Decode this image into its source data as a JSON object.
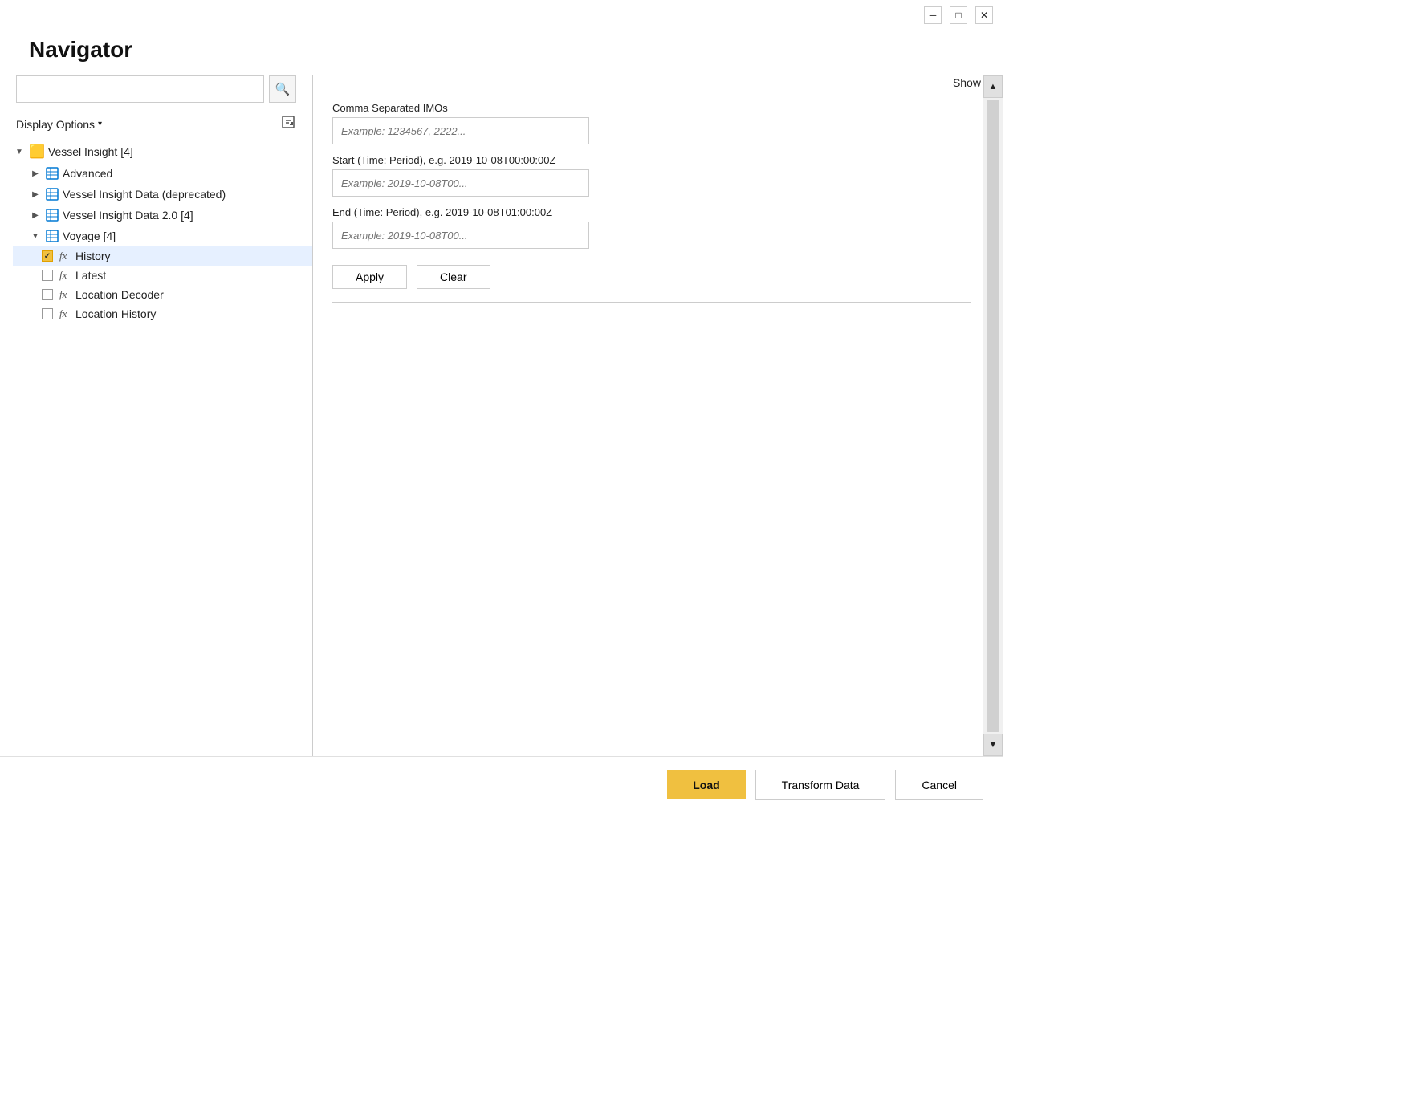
{
  "window": {
    "title": "Navigator",
    "minimize_label": "─",
    "maximize_label": "□",
    "close_label": "✕"
  },
  "search": {
    "placeholder": "",
    "icon": "🔍"
  },
  "display_options": {
    "label": "Display Options",
    "dropdown_icon": "▾"
  },
  "export_icon": "📄",
  "tree": {
    "root": {
      "label": "Vessel Insight [4]",
      "children": [
        {
          "label": "Advanced",
          "type": "table",
          "indent": 1,
          "expandable": true
        },
        {
          "label": "Vessel Insight Data (deprecated)",
          "type": "table",
          "indent": 1,
          "expandable": true
        },
        {
          "label": "Vessel Insight Data 2.0 [4]",
          "type": "table",
          "indent": 1,
          "expandable": true
        },
        {
          "label": "Voyage [4]",
          "type": "table",
          "indent": 1,
          "expandable": true,
          "children": [
            {
              "label": "History",
              "type": "fx",
              "indent": 2,
              "checked": true,
              "selected": true
            },
            {
              "label": "Latest",
              "type": "fx",
              "indent": 2,
              "checked": false
            },
            {
              "label": "Location Decoder",
              "type": "fx",
              "indent": 2,
              "checked": false
            },
            {
              "label": "Location History",
              "type": "fx",
              "indent": 2,
              "checked": false
            }
          ]
        }
      ]
    }
  },
  "right_panel": {
    "show_label": "Show",
    "show_dropdown_icon": "▾",
    "form": {
      "fields": [
        {
          "label": "Comma Separated IMOs",
          "placeholder": "Example: 1234567, 2222..."
        },
        {
          "label": "Start (Time: Period), e.g. 2019-10-08T00:00:00Z",
          "placeholder": "Example: 2019-10-08T00..."
        },
        {
          "label": "End (Time: Period), e.g. 2019-10-08T01:00:00Z",
          "placeholder": "Example: 2019-10-08T00..."
        }
      ],
      "apply_label": "Apply",
      "clear_label": "Clear"
    }
  },
  "bottom_bar": {
    "load_label": "Load",
    "transform_label": "Transform Data",
    "cancel_label": "Cancel"
  }
}
